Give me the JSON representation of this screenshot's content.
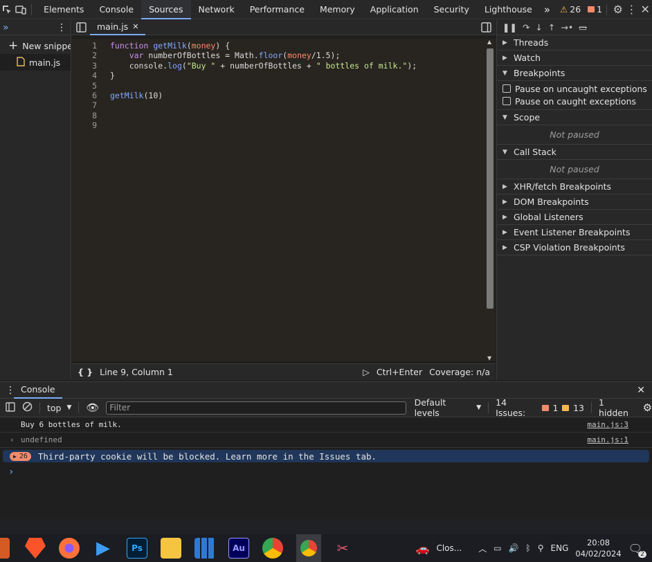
{
  "topbar": {
    "tabs": [
      "Elements",
      "Console",
      "Sources",
      "Network",
      "Performance",
      "Memory",
      "Application",
      "Security",
      "Lighthouse"
    ],
    "active_tab": "Sources",
    "more_tabs": "»",
    "warning_count": "26",
    "error_count": "1"
  },
  "navigator": {
    "new_snippet": "New snippet",
    "file": "main.js"
  },
  "editor": {
    "tab_label": "main.js",
    "lines": [
      {
        "n": "1",
        "code": "function getMilk(money) {"
      },
      {
        "n": "2",
        "code": "    var numberOfBottles = Math.floor(money/1.5);"
      },
      {
        "n": "3",
        "code": "    console.log(\"Buy \" + numberOfBottles + \" bottles of milk.\");"
      },
      {
        "n": "4",
        "code": "}"
      },
      {
        "n": "5",
        "code": ""
      },
      {
        "n": "6",
        "code": "getMilk(10)"
      },
      {
        "n": "7",
        "code": ""
      },
      {
        "n": "8",
        "code": ""
      },
      {
        "n": "9",
        "code": ""
      }
    ],
    "status_position": "Line 9, Column 1",
    "run_shortcut": "Ctrl+Enter",
    "coverage": "Coverage: n/a"
  },
  "debugger": {
    "threads": "Threads",
    "watch": "Watch",
    "breakpoints": "Breakpoints",
    "pause_uncaught": "Pause on uncaught exceptions",
    "pause_caught": "Pause on caught exceptions",
    "scope": "Scope",
    "scope_state": "Not paused",
    "call_stack": "Call Stack",
    "call_stack_state": "Not paused",
    "collapsed_sections": [
      "XHR/fetch Breakpoints",
      "DOM Breakpoints",
      "Global Listeners",
      "Event Listener Breakpoints",
      "CSP Violation Breakpoints"
    ]
  },
  "console": {
    "tab_label": "Console",
    "context": "top",
    "filter_placeholder": "Filter",
    "levels": "Default levels",
    "issues_label": "14 Issues:",
    "issues_errors": "1",
    "issues_warnings": "13",
    "hidden": "1 hidden",
    "messages": [
      {
        "text": "Buy 6 bottles of milk.",
        "link": "main.js:3"
      },
      {
        "text": "undefined",
        "link": "main.js:1"
      }
    ],
    "issue_count": "26",
    "issue_text": "Third-party cookie will be blocked. Learn more in the Issues tab.",
    "prompt": "›"
  },
  "taskbar": {
    "closing_label": "Clos...",
    "language": "ENG",
    "time": "20:08",
    "date": "04/02/2024",
    "notif_count": "2"
  },
  "colors": {
    "accent": "#7cacf8",
    "keyword": "#c792ea",
    "function_name": "#82aaff",
    "param": "#f78c6c",
    "string": "#c3e88d",
    "warning": "#f28b6b"
  }
}
